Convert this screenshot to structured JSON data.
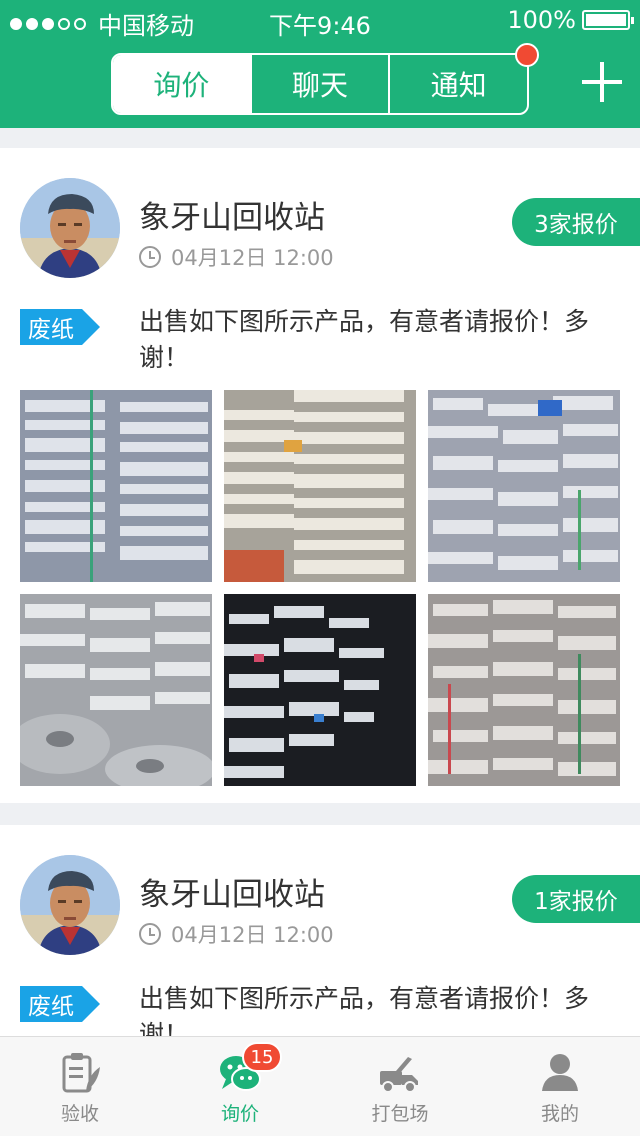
{
  "status_bar": {
    "carrier": "中国移动",
    "time": "下午9:46",
    "battery": "100%"
  },
  "header": {
    "tabs": [
      {
        "label": "询价",
        "active": true
      },
      {
        "label": "聊天",
        "active": false
      },
      {
        "label": "通知",
        "active": false,
        "has_dot": true
      }
    ],
    "add_icon": "plus-icon"
  },
  "posts": [
    {
      "seller": "象牙山回收站",
      "time": "04月12日 12:00",
      "quote_label": "3家报价",
      "category": "废纸",
      "description": "出售如下图所示产品，有意者请报价！多谢！",
      "photo_count": 6
    },
    {
      "seller": "象牙山回收站",
      "time": "04月12日 12:00",
      "quote_label": "1家报价",
      "category": "废纸",
      "description": "出售如下图所示产品，有意者请报价！多谢！"
    }
  ],
  "tabbar": {
    "items": [
      {
        "label": "验收",
        "icon": "clipboard-icon"
      },
      {
        "label": "询价",
        "icon": "chat-icon",
        "active": true
      },
      {
        "label": "打包场",
        "icon": "truck-icon"
      },
      {
        "label": "我的",
        "icon": "person-icon"
      }
    ],
    "badge": "15"
  },
  "colors": {
    "brand_green": "#1db27a",
    "tag_blue": "#1aa3e6",
    "badge_red": "#f04a33"
  }
}
